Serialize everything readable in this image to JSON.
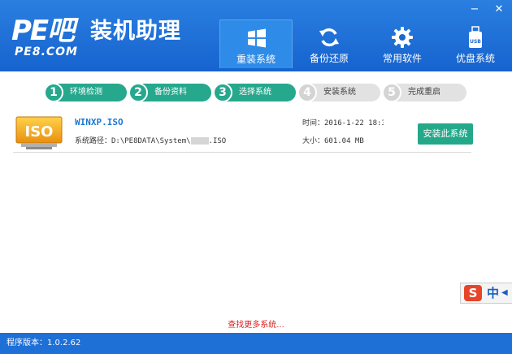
{
  "app": {
    "logo_mark": "PE吧",
    "title": "装机助理",
    "url": "PE8.COM"
  },
  "window_controls": {
    "minimize": "−",
    "close": "✕"
  },
  "nav": [
    {
      "label": "重装系统",
      "icon": "windows-icon",
      "active": true
    },
    {
      "label": "备份还原",
      "icon": "refresh-icon",
      "active": false
    },
    {
      "label": "常用软件",
      "icon": "gear-icon",
      "active": false
    },
    {
      "label": "优盘系统",
      "icon": "usb-icon",
      "active": false
    }
  ],
  "usb_text": "USB",
  "steps": [
    {
      "num": "1",
      "label": "环境检测",
      "state": "done"
    },
    {
      "num": "2",
      "label": "备份资料",
      "state": "done"
    },
    {
      "num": "3",
      "label": "选择系统",
      "state": "done"
    },
    {
      "num": "4",
      "label": "安装系统",
      "state": "todo"
    },
    {
      "num": "5",
      "label": "完成重启",
      "state": "todo"
    }
  ],
  "file": {
    "icon_text": "ISO",
    "name": "WINXP.ISO",
    "path_prefix": "系统路径：D:\\PE8DATA\\System\\",
    "path_suffix": ".ISO",
    "time": "时间：2016-1-22 18:3",
    "size": "大小：601.04 MB",
    "install_label": "安装此系统"
  },
  "more_link": "查找更多系统...",
  "ime": {
    "logo": "S",
    "lang": "中"
  },
  "version": "程序版本：1.0.2.62",
  "colors": {
    "header": "#1663cf",
    "accent": "#26a88d",
    "link": "#1c78d4",
    "warn": "#dd2222"
  }
}
